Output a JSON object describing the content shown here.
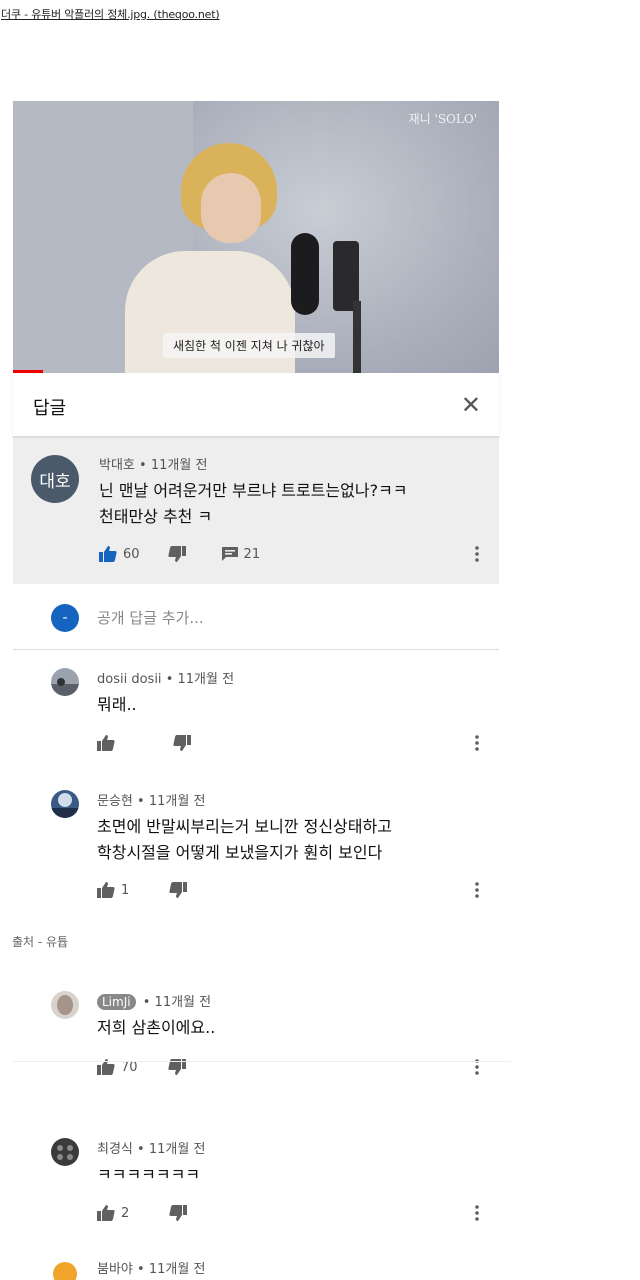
{
  "page_title": "더쿠 - 유튜버 악플러의 정체.jpg. (theqoo.net)",
  "video": {
    "watermark": "재니 'SOLO'",
    "subtitle": "새침한 척 이젠 지쳐 나 귀찮아"
  },
  "reply_panel": {
    "title": "답글",
    "close_icon": "close-icon"
  },
  "main_comment": {
    "avatar_text": "대호",
    "author": "박대호",
    "time": "11개월 전",
    "text_line1": "닌 맨날 어려운거만 부르냐 트로트는없나?ㅋㅋ",
    "text_line2": "천태만상 추천 ㅋ",
    "likes": "60",
    "replies": "21"
  },
  "add_reply": {
    "avatar_text": "-",
    "placeholder": "공개 답글 추가..."
  },
  "replies": [
    {
      "author": "dosii dosii",
      "time": "11개월 전",
      "text": "뭐래..",
      "likes": ""
    },
    {
      "author": "문승현",
      "time": "11개월 전",
      "text_line1": "초면에 반말씨부리는거 보니깐 정신상태하고",
      "text_line2": "학창시절을 어떻게 보냈을지가 훤히 보인다",
      "likes": "1"
    },
    {
      "author": "LimJi",
      "time": "11개월 전",
      "text": "저희 삼촌이에요..",
      "likes": "70"
    },
    {
      "author": "최경식",
      "time": "11개월 전",
      "text": "ㅋㅋㅋㅋㅋㅋㅋ",
      "likes": "2"
    },
    {
      "author": "붐바야",
      "time": "11개월 전"
    }
  ],
  "source_note": "출처 - 유튭",
  "separator": "•",
  "colors": {
    "like_blue": "#1565c0",
    "icon_gray": "#606060",
    "panel_bg": "#eeeeee"
  }
}
